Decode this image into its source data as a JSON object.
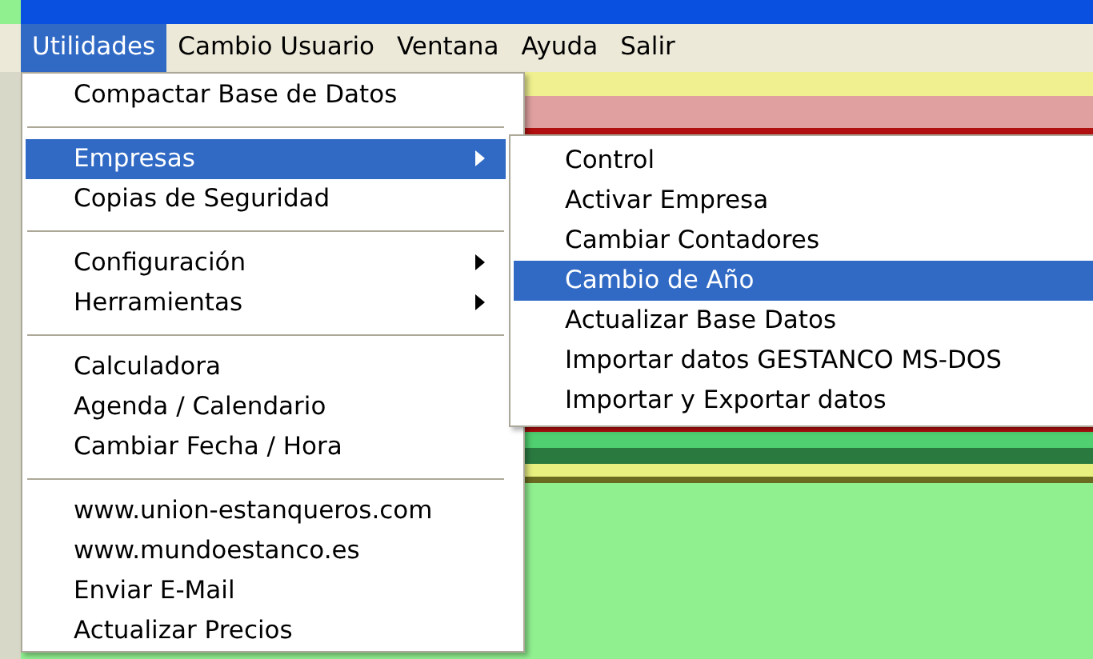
{
  "menubar": [
    {
      "label": "Utilidades",
      "selected": true
    },
    {
      "label": "Cambio Usuario",
      "selected": false
    },
    {
      "label": "Ventana",
      "selected": false
    },
    {
      "label": "Ayuda",
      "selected": false
    },
    {
      "label": "Salir",
      "selected": false
    }
  ],
  "menu": [
    {
      "kind": "item",
      "label": "Compactar Base de Datos",
      "selected": false,
      "submenu": false
    },
    {
      "kind": "separator"
    },
    {
      "kind": "item",
      "label": "Empresas",
      "selected": true,
      "submenu": true
    },
    {
      "kind": "item",
      "label": "Copias de Seguridad",
      "selected": false,
      "submenu": false
    },
    {
      "kind": "separator"
    },
    {
      "kind": "item",
      "label": "Configuración",
      "selected": false,
      "submenu": true
    },
    {
      "kind": "item",
      "label": "Herramientas",
      "selected": false,
      "submenu": true
    },
    {
      "kind": "separator"
    },
    {
      "kind": "item",
      "label": "Calculadora",
      "selected": false,
      "submenu": false
    },
    {
      "kind": "item",
      "label": "Agenda / Calendario",
      "selected": false,
      "submenu": false
    },
    {
      "kind": "item",
      "label": "Cambiar Fecha / Hora",
      "selected": false,
      "submenu": false
    },
    {
      "kind": "separator"
    },
    {
      "kind": "item",
      "label": "www.union-estanqueros.com",
      "selected": false,
      "submenu": false
    },
    {
      "kind": "item",
      "label": "www.mundoestanco.es",
      "selected": false,
      "submenu": false
    },
    {
      "kind": "item",
      "label": "Enviar E-Mail",
      "selected": false,
      "submenu": false
    },
    {
      "kind": "item",
      "label": "Actualizar Precios",
      "selected": false,
      "submenu": false
    }
  ],
  "submenu": [
    {
      "label": "Control",
      "selected": false
    },
    {
      "label": "Activar Empresa",
      "selected": false
    },
    {
      "label": "Cambiar Contadores",
      "selected": false
    },
    {
      "label": "Cambio de Año",
      "selected": true
    },
    {
      "label": "Actualizar Base Datos",
      "selected": false
    },
    {
      "label": "Importar datos GESTANCO MS-DOS",
      "selected": false
    },
    {
      "label": "Importar y Exportar datos",
      "selected": false
    }
  ]
}
